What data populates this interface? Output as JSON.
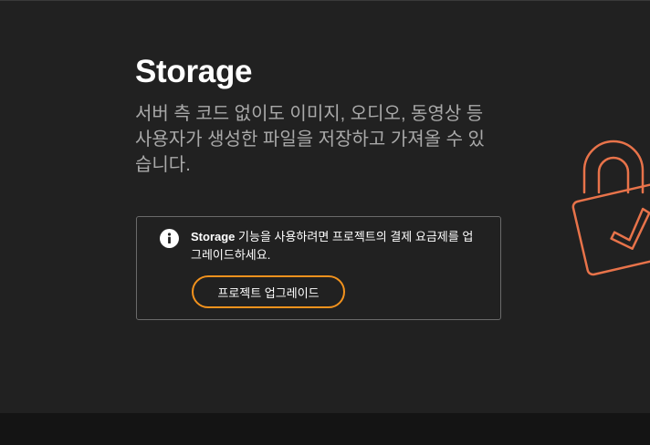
{
  "page": {
    "title": "Storage",
    "description": "서버 측 코드 없이도 이미지, 오디오, 동영상 등 사용자가 생성한 파일을 저장하고 가져올 수 있습니다."
  },
  "notice": {
    "icon": "info-icon",
    "product_name": "Storage",
    "message": " 기능을 사용하려면 프로젝트의 결제 요금제를 업그레이드하세요.",
    "upgrade_button_label": "프로젝트 업그레이드"
  },
  "illustration": {
    "icon": "lock-icon",
    "accent_color": "#e8734a"
  },
  "colors": {
    "background": "#212121",
    "footer": "#141414",
    "button_border": "#f2921d",
    "description_text": "#a9a9a9"
  }
}
